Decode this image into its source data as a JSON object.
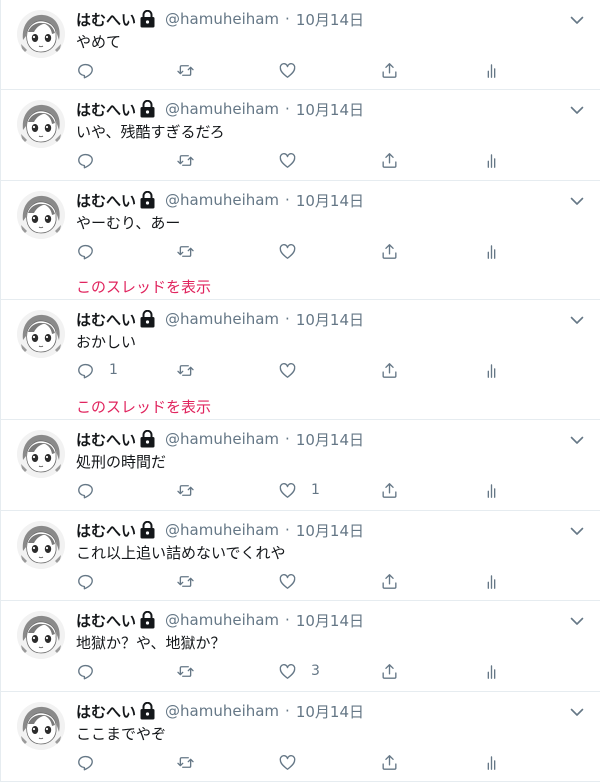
{
  "colors": {
    "border": "#e6ecf0",
    "secondary": "#657786",
    "link": "#e0245e",
    "text": "#14171a"
  },
  "tweets": [
    {
      "name": "はむへい",
      "handle": "@hamuheiham",
      "date": "10月14日",
      "text": "やめて",
      "reply_count": "",
      "like_count": "",
      "thread": ""
    },
    {
      "name": "はむへい",
      "handle": "@hamuheiham",
      "date": "10月14日",
      "text": "いや、残酷すぎるだろ",
      "reply_count": "",
      "like_count": "",
      "thread": ""
    },
    {
      "name": "はむへい",
      "handle": "@hamuheiham",
      "date": "10月14日",
      "text": "やーむり、あー",
      "reply_count": "",
      "like_count": "",
      "thread": "このスレッドを表示"
    },
    {
      "name": "はむへい",
      "handle": "@hamuheiham",
      "date": "10月14日",
      "text": "おかしい",
      "reply_count": "1",
      "like_count": "",
      "thread": "このスレッドを表示"
    },
    {
      "name": "はむへい",
      "handle": "@hamuheiham",
      "date": "10月14日",
      "text": "処刑の時間だ",
      "reply_count": "",
      "like_count": "1",
      "thread": ""
    },
    {
      "name": "はむへい",
      "handle": "@hamuheiham",
      "date": "10月14日",
      "text": "これ以上追い詰めないでくれや",
      "reply_count": "",
      "like_count": "",
      "thread": ""
    },
    {
      "name": "はむへい",
      "handle": "@hamuheiham",
      "date": "10月14日",
      "text": "地獄か？や、地獄か？",
      "reply_count": "",
      "like_count": "3",
      "thread": ""
    },
    {
      "name": "はむへい",
      "handle": "@hamuheiham",
      "date": "10月14日",
      "text": "ここまでやぞ",
      "reply_count": "",
      "like_count": "",
      "thread": ""
    }
  ],
  "icons": {
    "lock": "lock-icon",
    "menu": "chevron-down-icon",
    "reply": "reply-icon",
    "retweet": "retweet-icon",
    "like": "heart-icon",
    "share": "share-icon",
    "analytics": "analytics-icon"
  }
}
